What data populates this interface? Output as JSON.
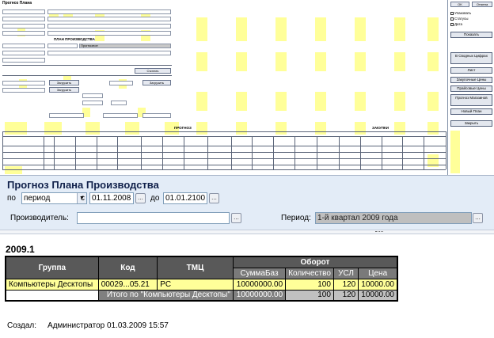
{
  "designer": {
    "title": "Прогноз Плана",
    "section_product": "ПЛАН ПРОИЗВОДСТВА",
    "section_forecast": "ПРОГНОЗ",
    "section_stock": "ЗАКУПКИ",
    "btn_calc": "Считать",
    "btn_load1": "Загрузить",
    "btn_load2": "Загрузить",
    "btn_load3": "Загрузить",
    "select_forecast": "Прогнозное",
    "right": {
      "top_btn1": "OK",
      "top_btn2": "Отмена",
      "chk1": "Упаковать",
      "chk2": "Статусы",
      "chk3": "Дата",
      "btn_show": "Показать",
      "btn_export": "В Сводных Цифрах",
      "btn_sheet": "Лист",
      "btn_prices1": "Закупочные Цены",
      "btn_prices2": "Прайсовые Цены",
      "btn_forecast": "Прогноз Магазинов",
      "btn_newplan": "Новый План",
      "btn_close": "Закрыть"
    }
  },
  "params": {
    "title": "Прогноз Плана Производства",
    "po_label": "по",
    "period_select": "период",
    "from_label": "с",
    "from_date": "01.11.2008",
    "to_label": "до",
    "to_date": "01.01.2100",
    "producer_label": "Производитель:",
    "producer_value": "",
    "period_label": "Период:",
    "period_value": "1-й квартал 2009 года",
    "dots": "..."
  },
  "report": {
    "year": "2009.1",
    "headers": {
      "group": "Группа",
      "code": "Код",
      "item": "ТМЦ",
      "turnover": "Оборот",
      "sum": "СуммаБаз",
      "qty": "Количество",
      "usl": "УСЛ",
      "price": "Цена"
    },
    "rows": [
      {
        "group": "Компьютеры Десктопы",
        "code": "00029...05.21",
        "item": "PC",
        "sum": "10000000.00",
        "qty": "100",
        "usl": "120",
        "price": "10000.00"
      }
    ],
    "total": {
      "label": "Итого по \"Компьютеры Десктопы\"",
      "sum": "10000000.00",
      "qty": "100",
      "usl": "120",
      "price": "10000.00"
    },
    "created_label": "Создал:",
    "created_value": "Администратор 01.03.2009 15:57"
  }
}
